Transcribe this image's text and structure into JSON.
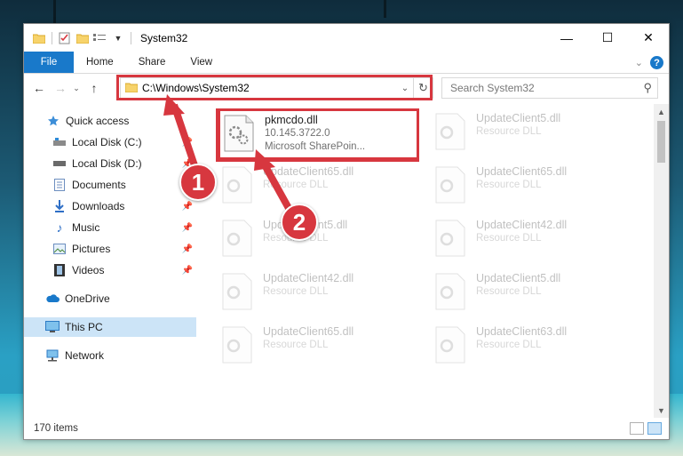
{
  "window": {
    "title": "System32",
    "controls": {
      "minimize": "—",
      "maximize": "☐",
      "close": "✕"
    }
  },
  "ribbon": {
    "tabs": [
      {
        "label": "File"
      },
      {
        "label": "Home"
      },
      {
        "label": "Share"
      },
      {
        "label": "View"
      }
    ]
  },
  "nav": {
    "address": "C:\\Windows\\System32",
    "search_placeholder": "Search System32"
  },
  "sidebar": {
    "items": [
      {
        "label": "Quick access",
        "icon": "star-icon"
      },
      {
        "label": "Local Disk (C:)",
        "icon": "drive-icon"
      },
      {
        "label": "Local Disk (D:)",
        "icon": "drive-icon"
      },
      {
        "label": "Documents",
        "icon": "documents-icon"
      },
      {
        "label": "Downloads",
        "icon": "download-icon"
      },
      {
        "label": "Music",
        "icon": "music-icon"
      },
      {
        "label": "Pictures",
        "icon": "pictures-icon"
      },
      {
        "label": "Videos",
        "icon": "videos-icon"
      },
      {
        "label": "OneDrive",
        "icon": "cloud-icon"
      },
      {
        "label": "This PC",
        "icon": "computer-icon"
      },
      {
        "label": "Network",
        "icon": "network-icon"
      }
    ]
  },
  "files": [
    {
      "name": "pkmcdo.dll",
      "line2": "10.145.3722.0",
      "line3": "Microsoft SharePoin..."
    },
    {
      "name": "UpdateClient5.dll",
      "line2": "Resource DLL"
    },
    {
      "name": "UpdateClient65.dll",
      "line2": "Resource DLL"
    },
    {
      "name": "UpdateClient65.dll",
      "line2": "Resource DLL"
    },
    {
      "name": "UpdateClient5.dll",
      "line2": "Resource DLL"
    },
    {
      "name": "UpdateClient42.dll",
      "line2": "Resource DLL"
    },
    {
      "name": "UpdateClient42.dll",
      "line2": "Resource DLL"
    },
    {
      "name": "UpdateClient5.dll",
      "line2": "Resource DLL"
    },
    {
      "name": "UpdateClient65.dll",
      "line2": "Resource DLL"
    },
    {
      "name": "UpdateClient63.dll",
      "line2": "Resource DLL"
    }
  ],
  "status": {
    "count": "170 items"
  },
  "annotations": {
    "badge1": "1",
    "badge2": "2",
    "color": "#d7373f"
  }
}
